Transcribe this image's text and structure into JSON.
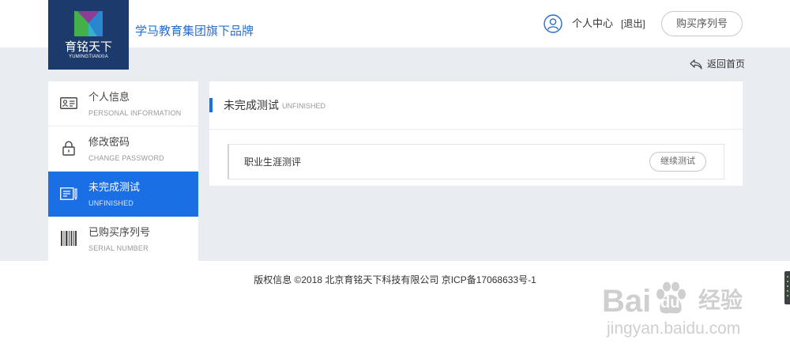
{
  "header": {
    "logo": {
      "title": "育铭天下",
      "subtitle": "YUMINGTIANXIA"
    },
    "brand_tagline": "学马教育集团旗下品牌",
    "user_icon": "user-circle-icon",
    "user_center": "个人中心",
    "logout": "[退出]",
    "buy_serial": "购买序列号"
  },
  "back_home": {
    "icon": "back-arrow-icon",
    "label": "返回首页"
  },
  "sidebar": {
    "items": [
      {
        "label": "个人信息",
        "sublabel": "PERSONAL INFORMATION",
        "icon": "id-card-icon",
        "active": false
      },
      {
        "label": "修改密码",
        "sublabel": "CHANGE PASSWORD",
        "icon": "lock-icon",
        "active": false
      },
      {
        "label": "未完成测试",
        "sublabel": "UNFINISHED",
        "icon": "clipboard-edit-icon",
        "active": true
      },
      {
        "label": "已购买序列号",
        "sublabel": "SERIAL NUMBER",
        "icon": "barcode-icon",
        "active": false
      }
    ]
  },
  "main": {
    "title": "未完成测试",
    "title_en": "UNFINISHED",
    "tests": [
      {
        "name": "职业生涯测评",
        "action": "继续测试"
      }
    ]
  },
  "footer": {
    "copyright": "版权信息 ©2018 北京育铭天下科技有限公司 京ICP备17068633号-1"
  },
  "watermark": {
    "bai": "Bai",
    "du": "du",
    "cn": "经验",
    "url": "jingyan.baidu.com"
  },
  "colors": {
    "primary": "#1b6fe5",
    "logo_bg": "#1d3a6c",
    "page_bg": "#e9edf2",
    "brand_text": "#2a6ccf"
  }
}
